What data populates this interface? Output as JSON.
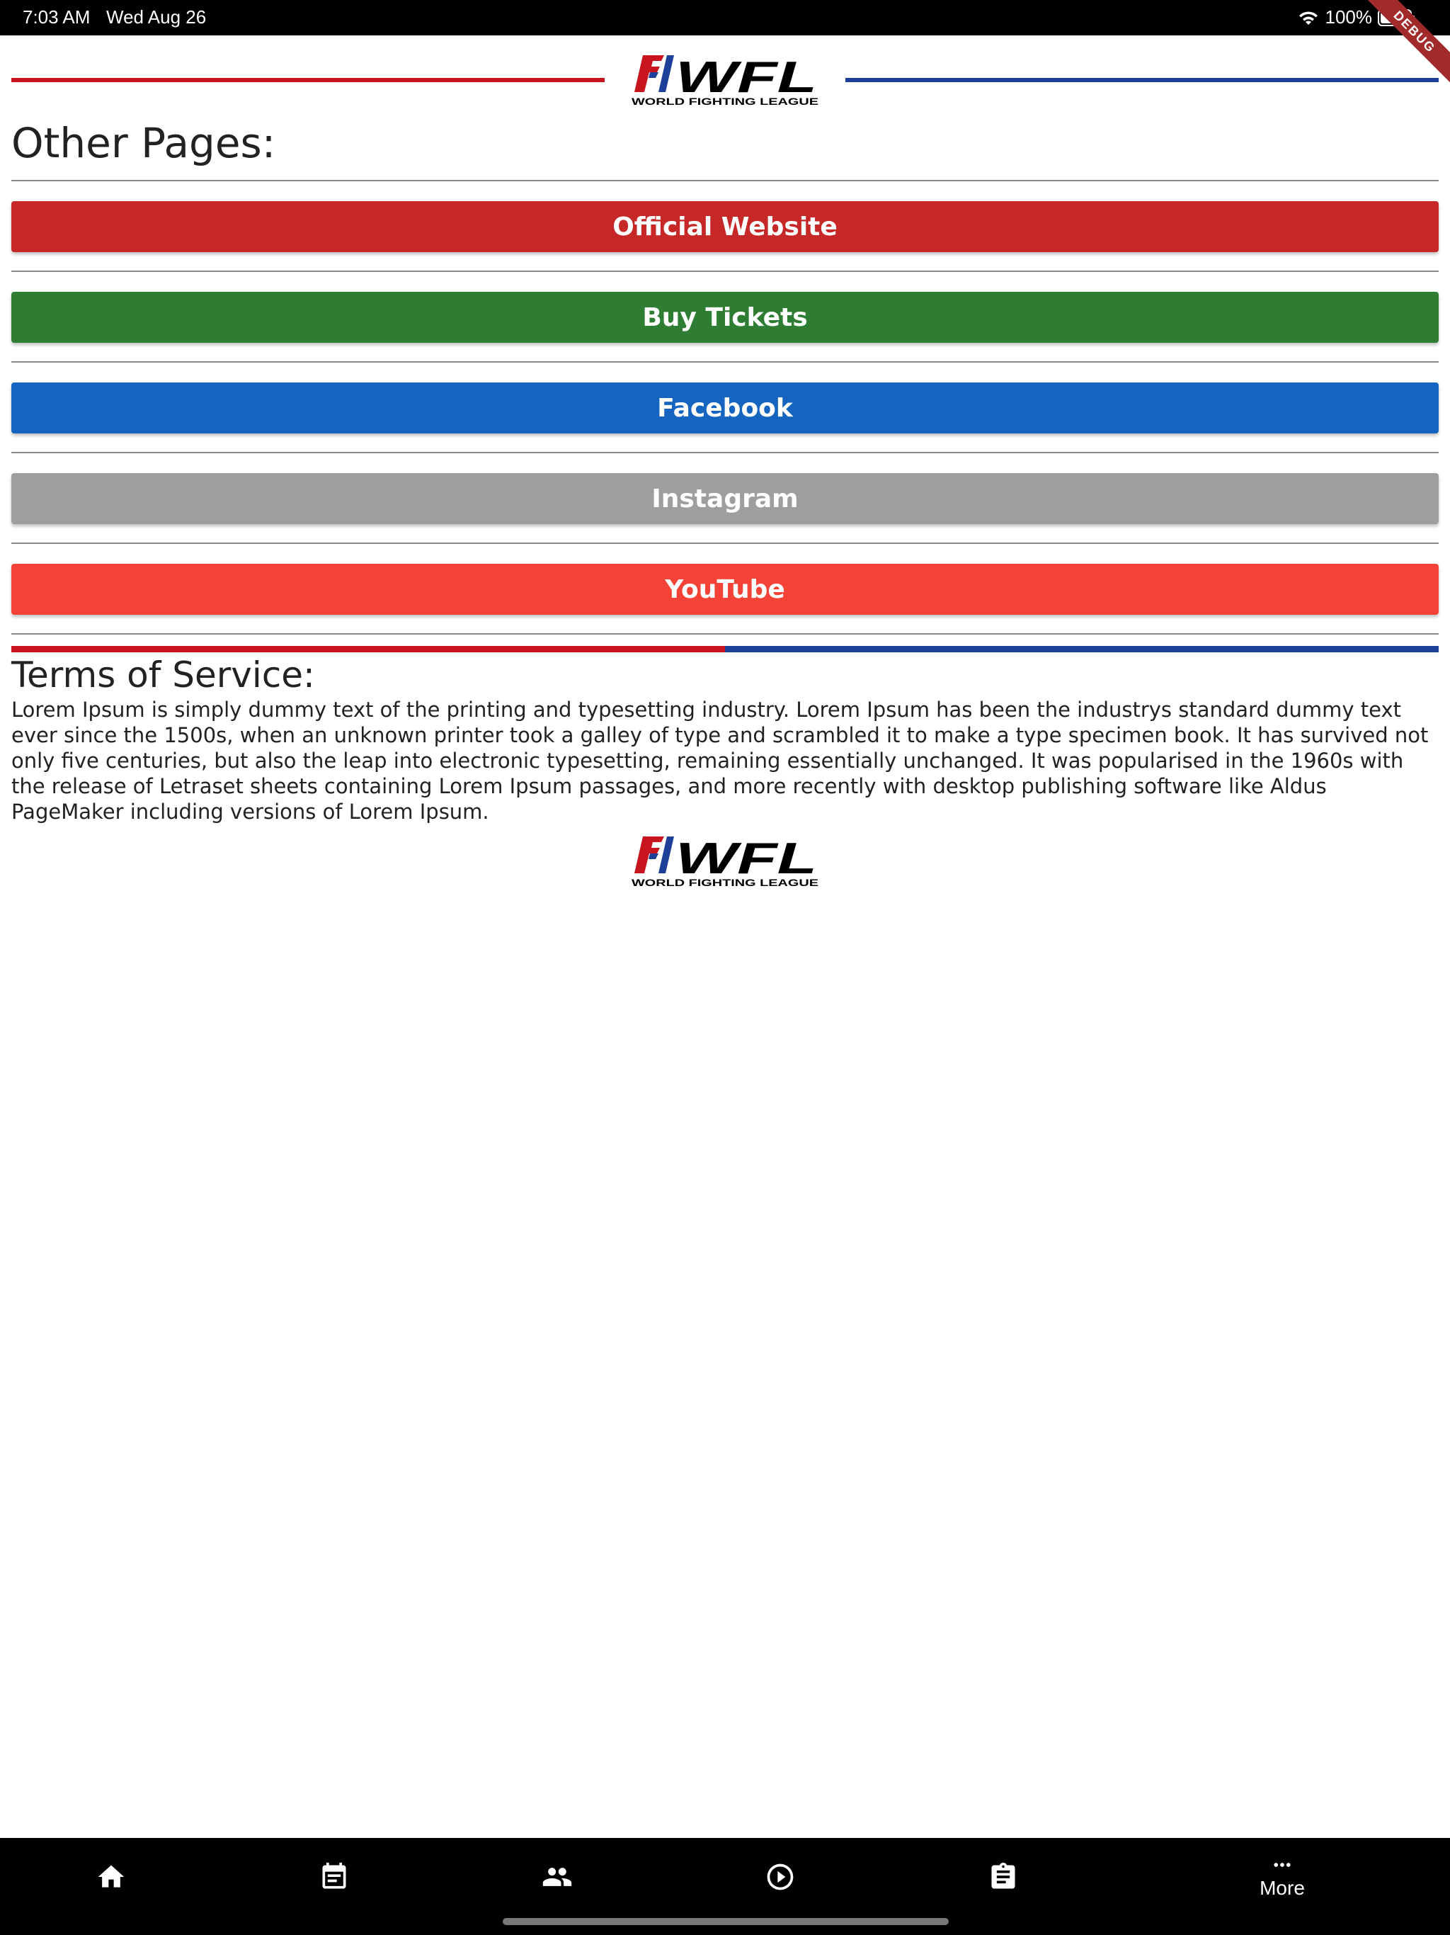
{
  "status_bar": {
    "time": "7:03 AM",
    "date": "Wed Aug 26",
    "battery": "100%",
    "icons": [
      "wifi-icon",
      "battery-icon"
    ]
  },
  "debug_banner": "DEBUG",
  "logo": {
    "mark": "WFL",
    "tagline": "WORLD FIGHTING LEAGUE",
    "colors": {
      "red": "#c8141c",
      "blue": "#1d3f9a",
      "black": "#000000"
    }
  },
  "other_pages": {
    "title": "Other Pages:",
    "buttons": [
      {
        "label": "Official Website",
        "color": "#c62828"
      },
      {
        "label": "Buy Tickets",
        "color": "#2e7d32"
      },
      {
        "label": "Facebook",
        "color": "#1565c0"
      },
      {
        "label": "Instagram",
        "color": "#9e9e9e"
      },
      {
        "label": "YouTube",
        "color": "#f44336"
      }
    ]
  },
  "terms": {
    "title": "Terms of Service:",
    "body": "Lorem Ipsum is simply dummy text of the printing and typesetting industry. Lorem Ipsum has been the industrys standard dummy text ever since the 1500s, when an unknown printer took a galley of type and scrambled it to make a type specimen book. It has survived not only five centuries, but also the leap into electronic typesetting, remaining essentially unchanged. It was popularised in the 1960s with the release of Letraset sheets containing Lorem Ipsum passages, and more recently with desktop publishing software like Aldus PageMaker including versions of Lorem Ipsum."
  },
  "bottom_nav": {
    "items": [
      {
        "icon": "home-icon",
        "label": ""
      },
      {
        "icon": "events-icon",
        "label": ""
      },
      {
        "icon": "fighters-icon",
        "label": ""
      },
      {
        "icon": "play-icon",
        "label": ""
      },
      {
        "icon": "clipboard-icon",
        "label": ""
      },
      {
        "icon": "more-icon",
        "label": "More"
      }
    ]
  }
}
